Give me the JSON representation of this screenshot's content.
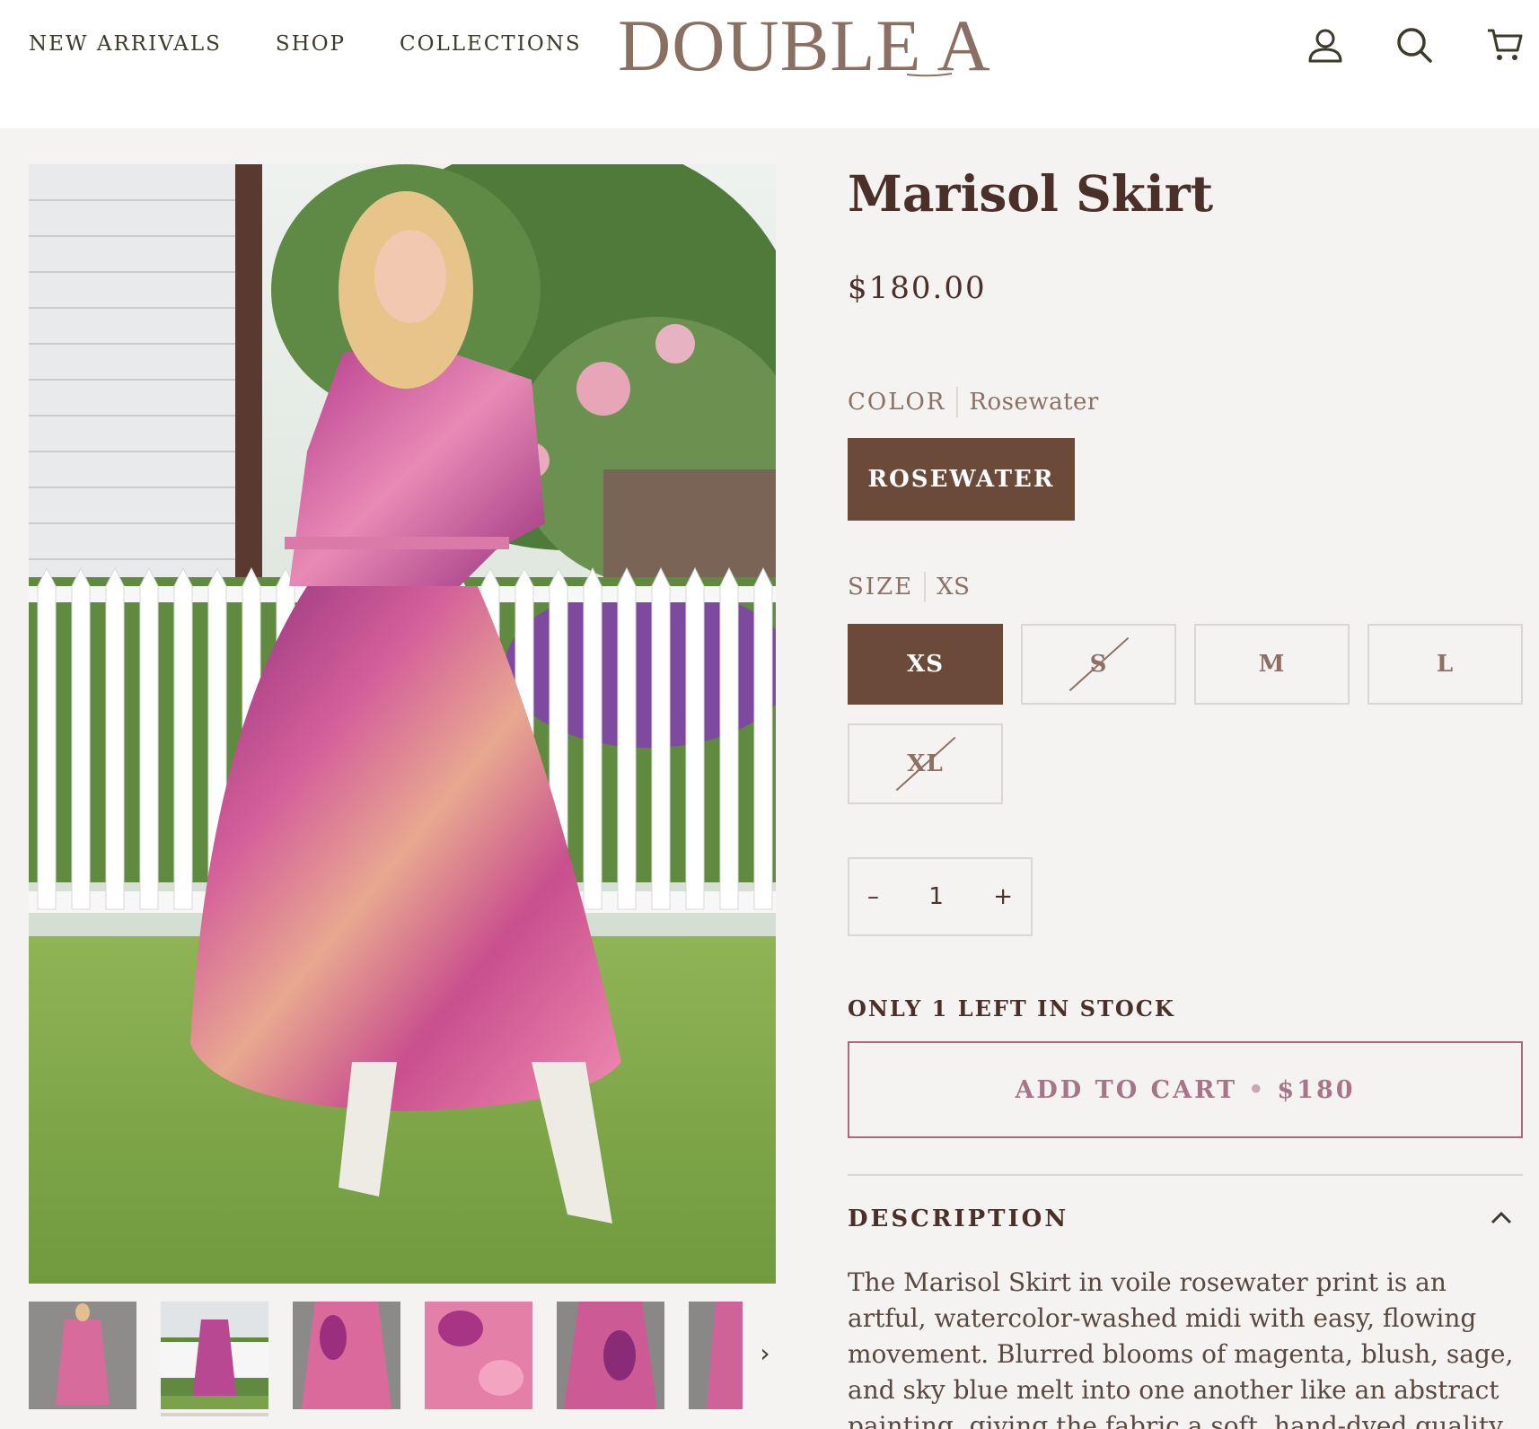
{
  "nav": {
    "items": [
      "NEW ARRIVALS",
      "SHOP",
      "COLLECTIONS"
    ],
    "logo": "DOUBLE A",
    "icons": [
      "account-icon",
      "search-icon",
      "cart-icon"
    ]
  },
  "product": {
    "title": "Marisol Skirt",
    "price": "$180.00",
    "color_label": "COLOR",
    "color_value": "Rosewater",
    "color_option": "ROSEWATER",
    "size_label": "SIZE",
    "size_value": "XS",
    "sizes": [
      {
        "label": "XS",
        "selected": true,
        "available": true
      },
      {
        "label": "S",
        "selected": false,
        "available": false
      },
      {
        "label": "M",
        "selected": false,
        "available": true
      },
      {
        "label": "L",
        "selected": false,
        "available": true
      },
      {
        "label": "XL",
        "selected": false,
        "available": false
      }
    ],
    "quantity": {
      "minus": "–",
      "value": "1",
      "plus": "+"
    },
    "stock": "ONLY 1 LEFT IN STOCK",
    "cart": {
      "label": "ADD TO CART",
      "dot": "•",
      "price": "$180"
    },
    "description_heading": "DESCRIPTION",
    "description": "The Marisol Skirt in voile rosewater print is an artful, watercolor-washed midi with easy, flowing movement. Blurred blooms of magenta, blush, sage, and sky blue melt into one another like an abstract painting, giving the fabric a soft, hand-dyed quality. An elasticized waistband flows"
  },
  "gallery": {
    "next_label": "›",
    "thumb_count": 6,
    "active_thumb": 1
  },
  "colors": {
    "brand_brown": "#6b4a3a",
    "logo": "#8a7062",
    "cart_border": "#a96a80",
    "background": "#f5f3f1"
  }
}
